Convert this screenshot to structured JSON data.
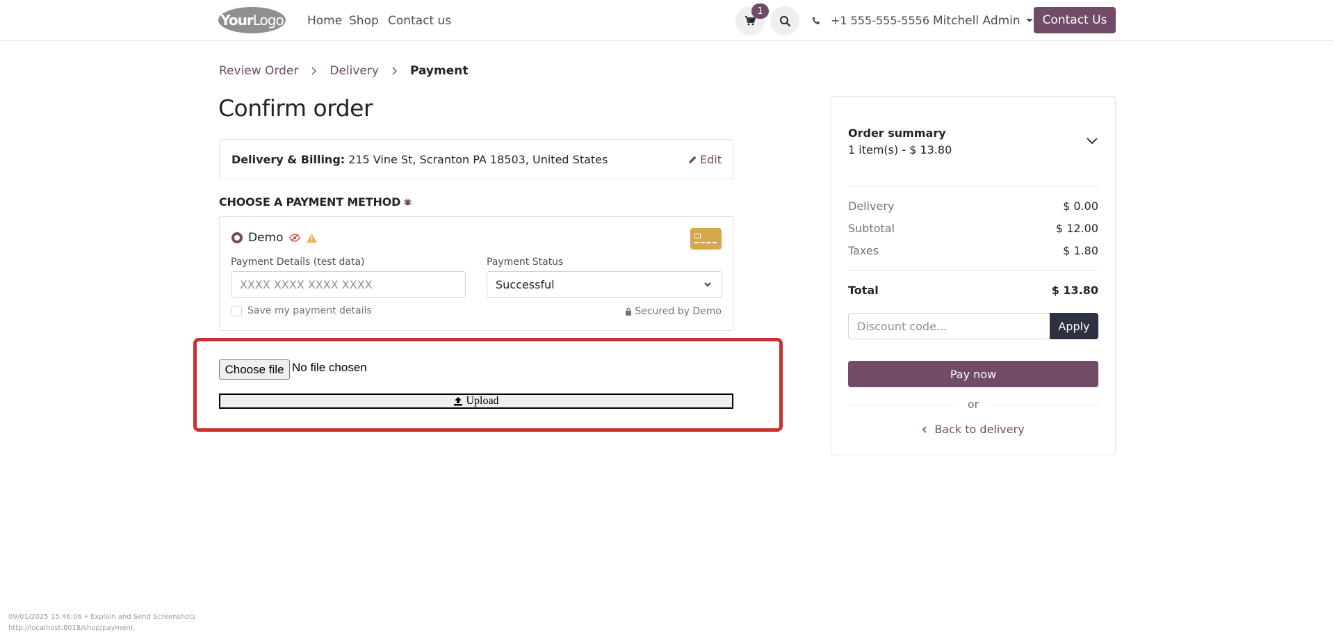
{
  "header": {
    "logo_bold": "Your",
    "logo_rest": "Logo",
    "nav": [
      "Home",
      "Shop",
      "Contact us"
    ],
    "cart_count": "1",
    "phone": "+1 555-555-5556",
    "user": "Mitchell Admin",
    "contact_button": "Contact Us"
  },
  "breadcrumb": [
    "Review Order",
    "Delivery",
    "Payment"
  ],
  "page_title": "Confirm order",
  "address": {
    "label": "Delivery & Billing:",
    "value": "215 Vine St, Scranton PA 18503, United States",
    "edit": "Edit"
  },
  "payment": {
    "heading": "CHOOSE A PAYMENT METHOD",
    "method_name": "Demo",
    "details_label": "Payment Details (test data)",
    "details_placeholder": "XXXX XXXX XXXX XXXX",
    "status_label": "Payment Status",
    "status_value": "Successful",
    "save_label": "Save my payment details",
    "secured": "Secured by Demo"
  },
  "upload": {
    "choose_file": "Choose file",
    "file_status": "No file chosen",
    "upload_label": "Upload"
  },
  "summary": {
    "title": "Order summary",
    "count": "1 item(s) -  $ 13.80",
    "rows": [
      {
        "label": "Delivery",
        "value": "$ 0.00"
      },
      {
        "label": "Subtotal",
        "value": "$ 12.00"
      },
      {
        "label": "Taxes",
        "value": "$ 1.80"
      }
    ],
    "total_label": "Total",
    "total_value": "$ 13.80",
    "discount_placeholder": "Discount code...",
    "apply": "Apply",
    "pay_now": "Pay now",
    "or": "or",
    "back": "Back to delivery"
  },
  "footer": {
    "line1": "09/01/2025 15:46:06 • Explain and Send Screenshots",
    "line2": "http://localhost:8018/shop/payment"
  },
  "colors": {
    "brand": "#714b67",
    "highlight": "#c9312f",
    "apply_button": "#2e3142"
  }
}
